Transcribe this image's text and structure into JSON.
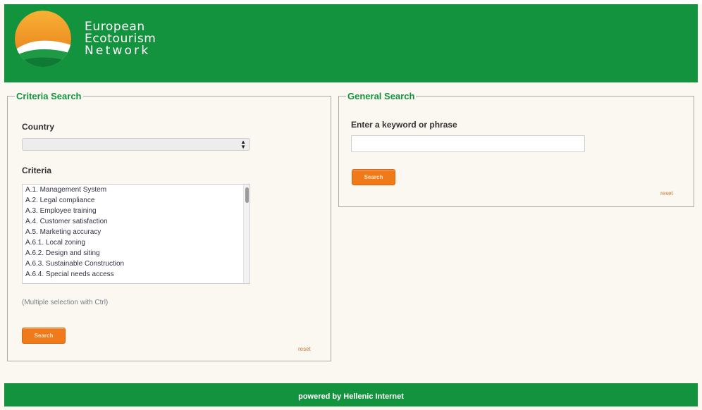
{
  "brand": {
    "line1": "European",
    "line2": "Ecotourism",
    "line3": "Network",
    "colors": {
      "green": "#13933e",
      "orange": "#f07a1a",
      "sun": "#f5a22a"
    }
  },
  "criteria_search": {
    "legend": "Criteria Search",
    "country_label": "Country",
    "country_value": "",
    "criteria_label": "Criteria",
    "criteria_options": [
      "A.1. Management System",
      "A.2. Legal compliance",
      "A.3. Employee training",
      "A.4. Customer satisfaction",
      "A.5. Marketing accuracy",
      "A.6.1. Local zoning",
      "A.6.2. Design and siting",
      "A.6.3. Sustainable Construction",
      "A.6.4. Special needs access"
    ],
    "hint": "(Multiple selection with Ctrl)",
    "search_button": "Search",
    "reset_link": "reset"
  },
  "general_search": {
    "legend": "General Search",
    "keyword_label": "Enter a keyword or phrase",
    "keyword_value": "",
    "search_button": "Search",
    "reset_link": "reset"
  },
  "footer": {
    "text": "powered by Hellenic Internet"
  }
}
